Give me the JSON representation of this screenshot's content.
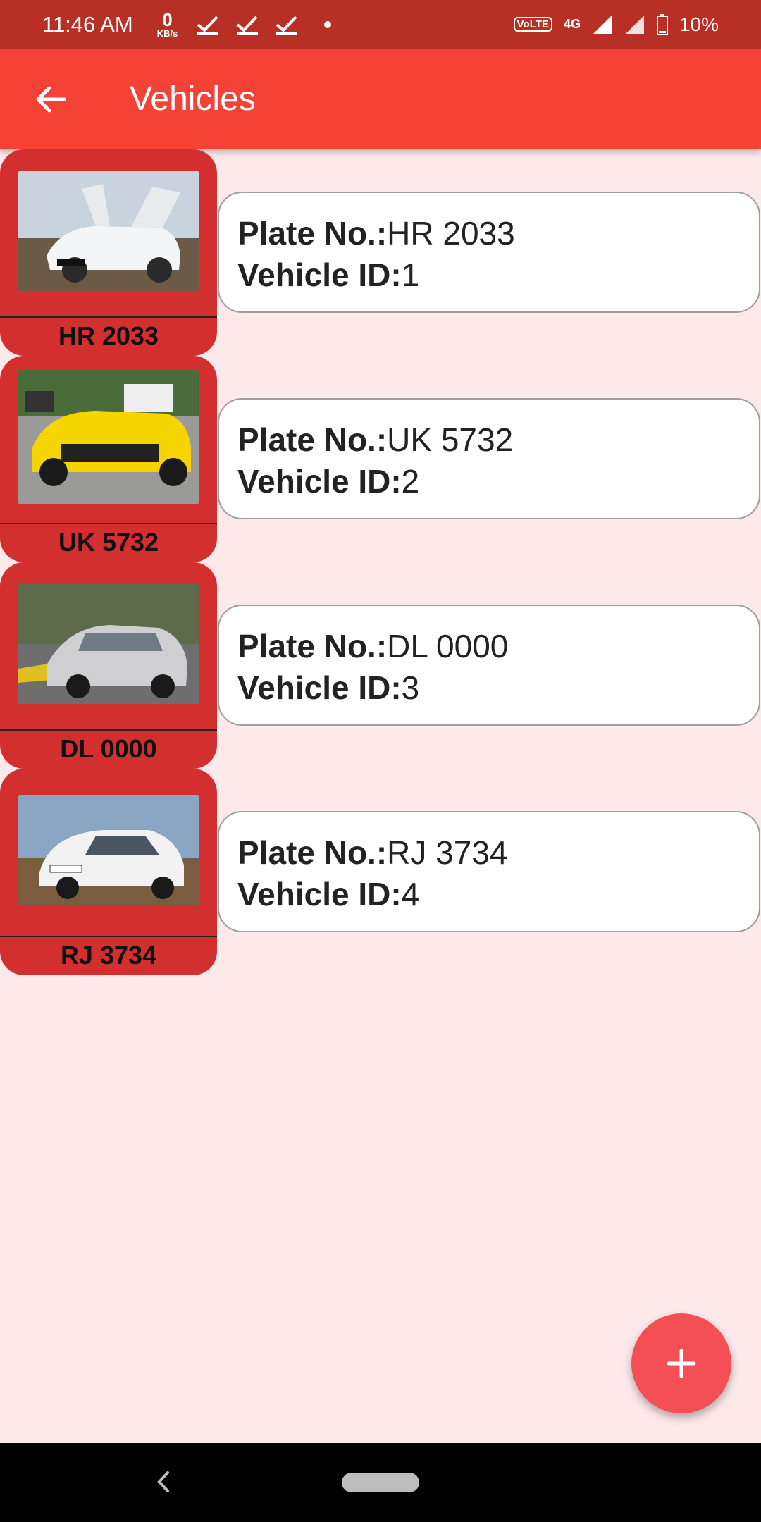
{
  "status_bar": {
    "time": "11:46 AM",
    "net_speed_value": "0",
    "net_speed_unit": "KB/s",
    "network": "4G",
    "volte": "VoLTE",
    "battery_percent": "10%"
  },
  "app_bar": {
    "title": "Vehicles",
    "back_icon": "arrow-back-icon"
  },
  "vehicles": [
    {
      "plate": "HR 2033",
      "id": "1",
      "plate_prefix": "Plate No.:",
      "id_prefix": "Vehicle ID:",
      "photo": "white-suv-photo"
    },
    {
      "plate": "UK 5732",
      "id": "2",
      "plate_prefix": "Plate No.:",
      "id_prefix": "Vehicle ID:",
      "photo": "yellow-sports-car-photo"
    },
    {
      "plate": "DL 0000",
      "id": "3",
      "plate_prefix": "Plate No.:",
      "id_prefix": "Vehicle ID:",
      "photo": "silver-sedan-photo"
    },
    {
      "plate": "RJ 3734",
      "id": "4",
      "plate_prefix": "Plate No.:",
      "id_prefix": "Vehicle ID:",
      "photo": "white-hatchback-photo"
    }
  ],
  "fab": {
    "icon": "plus-icon"
  },
  "colors": {
    "status_bar": "#b83025",
    "app_bar": "#f44336",
    "thumb_card": "#d32f2f",
    "background": "#fde9ea",
    "fab": "#f44f55"
  }
}
